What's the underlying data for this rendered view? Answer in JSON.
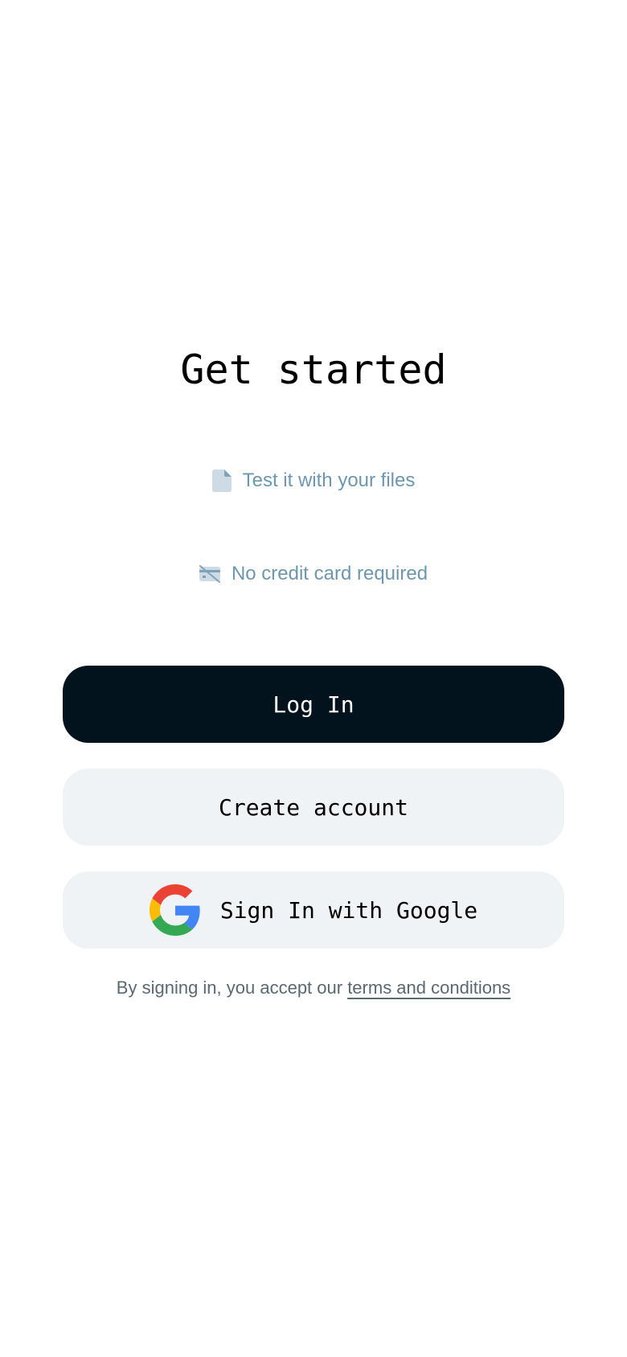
{
  "title": "Get started",
  "features": [
    {
      "icon": "file-icon",
      "text": "Test it with your files"
    },
    {
      "icon": "no-credit-card-icon",
      "text": "No credit card required"
    }
  ],
  "buttons": {
    "login": "Log In",
    "create_account": "Create account",
    "google": "Sign In with Google"
  },
  "terms": {
    "prefix": "By signing in, you accept our ",
    "link": "terms and conditions"
  },
  "colors": {
    "primary_button": "#03131e",
    "secondary_button": "#eff3f6",
    "feature_text": "#6e97ad",
    "terms_text": "#5a6872"
  }
}
